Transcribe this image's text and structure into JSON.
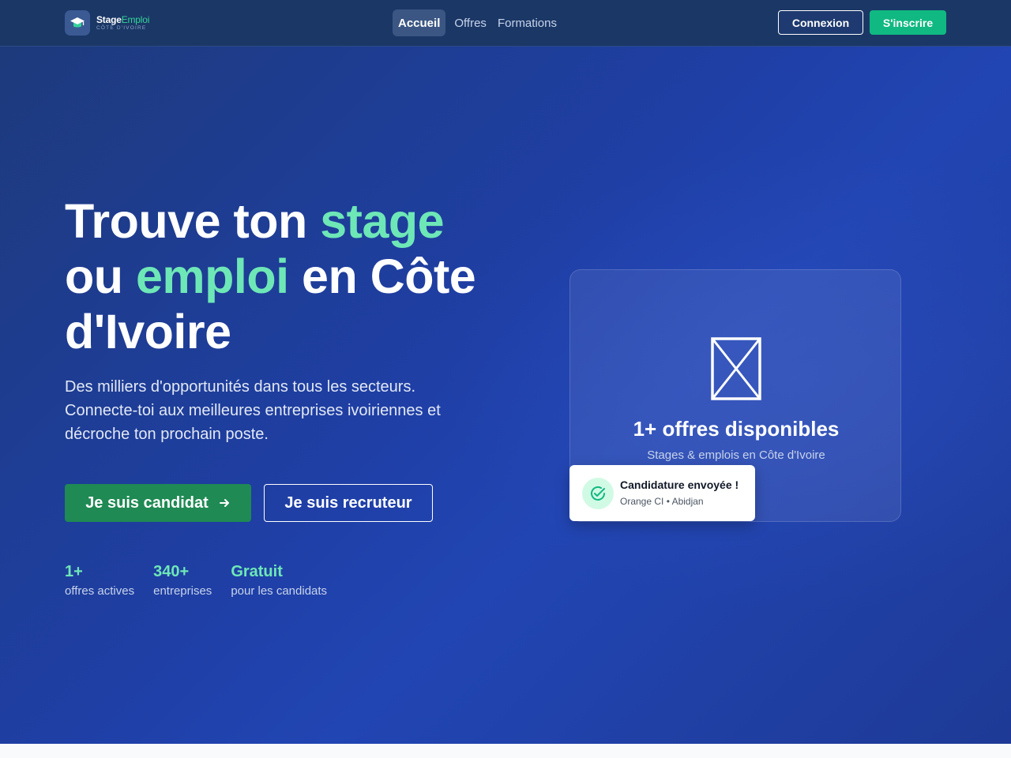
{
  "header": {
    "logo": {
      "name_part1": "Stage",
      "name_part2": "Emploi",
      "tagline": "CÔTE D'IVOIRE"
    },
    "nav": [
      {
        "label": "Accueil",
        "active": true
      },
      {
        "label": "Offres",
        "active": false
      },
      {
        "label": "Formations",
        "active": false
      }
    ],
    "login_label": "Connexion",
    "signup_label": "S'inscrire"
  },
  "hero": {
    "headline": {
      "part1": "Trouve ton ",
      "highlight1": "stage",
      "part2": "ou ",
      "highlight2": "emploi",
      "part3": " en Côte d'Ivoire"
    },
    "subtitle": "Des milliers d'opportunités dans tous les secteurs. Connecte-toi aux meilleures entreprises ivoiriennes et décroche ton prochain poste.",
    "candidate_button": "Je suis candidat",
    "recruiter_button": "Je suis recruteur",
    "stats": [
      {
        "value": "1+",
        "label": "offres actives"
      },
      {
        "value": "340+",
        "label": "entreprises"
      },
      {
        "value": "Gratuit",
        "label": "pour les candidats"
      }
    ]
  },
  "card": {
    "icon": "broken-image-icon",
    "title": "1+ offres disponibles",
    "subtitle": "Stages & emplois en Côte d'Ivoire"
  },
  "toast": {
    "icon": "check-circle-icon",
    "title": "Candidature envoyée !",
    "subtitle": "Orange CI • Abidjan"
  },
  "colors": {
    "accent_green": "#10b981",
    "highlight_green": "#6ee7b7",
    "header_bg": "#1b3766",
    "hero_blue": "#1f3fa6",
    "candidate_button": "#1f8a53"
  }
}
